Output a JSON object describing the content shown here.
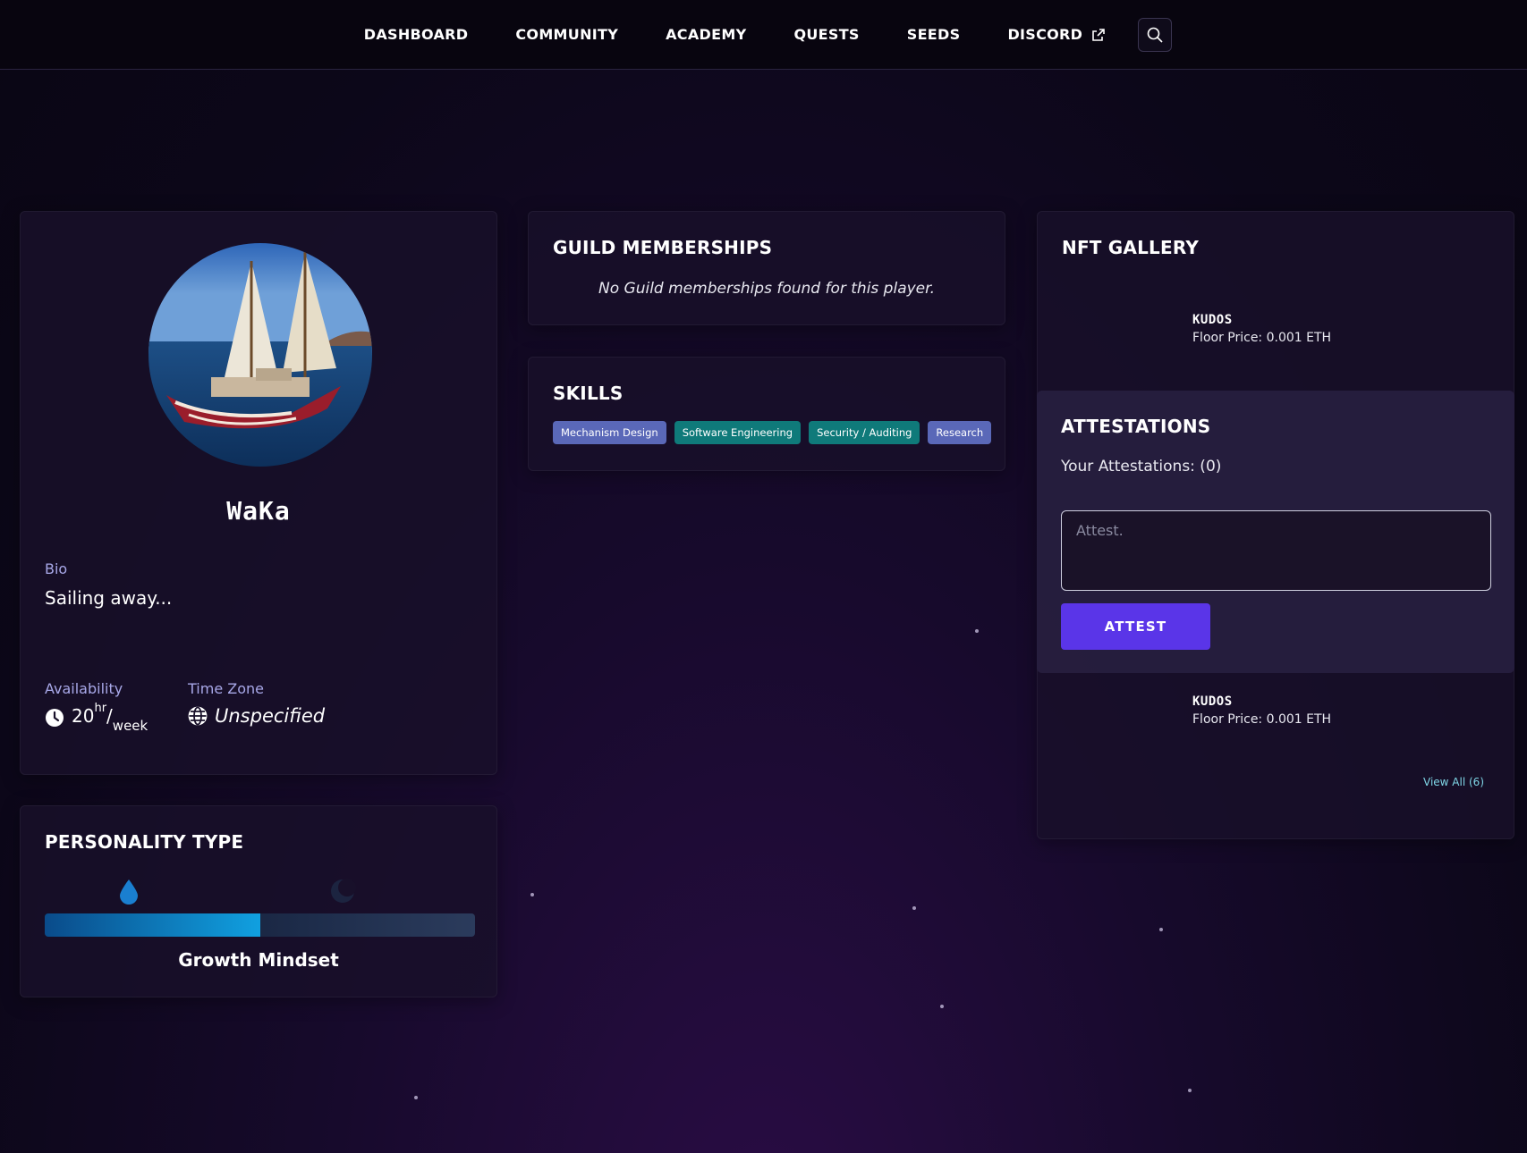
{
  "nav": {
    "items": [
      {
        "label": "DASHBOARD"
      },
      {
        "label": "COMMUNITY"
      },
      {
        "label": "ACADEMY"
      },
      {
        "label": "QUESTS"
      },
      {
        "label": "SEEDS"
      },
      {
        "label": "DISCORD"
      }
    ]
  },
  "profile": {
    "name": "WaKa",
    "bio_label": "Bio",
    "bio": "Sailing away...",
    "availability_label": "Availability",
    "availability_hours": "20",
    "availability_unit_top": "hr",
    "availability_unit_bottom": "week",
    "timezone_label": "Time Zone",
    "timezone": "Unspecified"
  },
  "personality": {
    "title": "PERSONALITY TYPE",
    "type": "Growth Mindset",
    "fill_fraction": 0.5
  },
  "guilds": {
    "title": "GUILD MEMBERSHIPS",
    "empty": "No Guild memberships found for this player."
  },
  "skills": {
    "title": "SKILLS",
    "tags": [
      {
        "label": "Mechanism Design",
        "color": "#5a68b8"
      },
      {
        "label": "Software Engineering",
        "color": "#0f7a7a"
      },
      {
        "label": "Security / Auditing",
        "color": "#0f7a7a"
      },
      {
        "label": "Research",
        "color": "#5a68b8"
      }
    ]
  },
  "nft": {
    "title": "NFT GALLERY",
    "items": [
      {
        "name": "KUDOS",
        "floor": "Floor Price: 0.001 ETH"
      },
      {
        "name": "KUDOS",
        "floor": "Floor Price: 0.001 ETH"
      }
    ],
    "view_all": "View All (6)"
  },
  "attestations": {
    "title": "ATTESTATIONS",
    "count_label": "Your Attestations: (0)",
    "placeholder": "Attest.",
    "button": "ATTEST"
  },
  "colors": {
    "accent": "#5a35e8",
    "label": "#a8a8e8",
    "link": "#7fd6e6"
  }
}
